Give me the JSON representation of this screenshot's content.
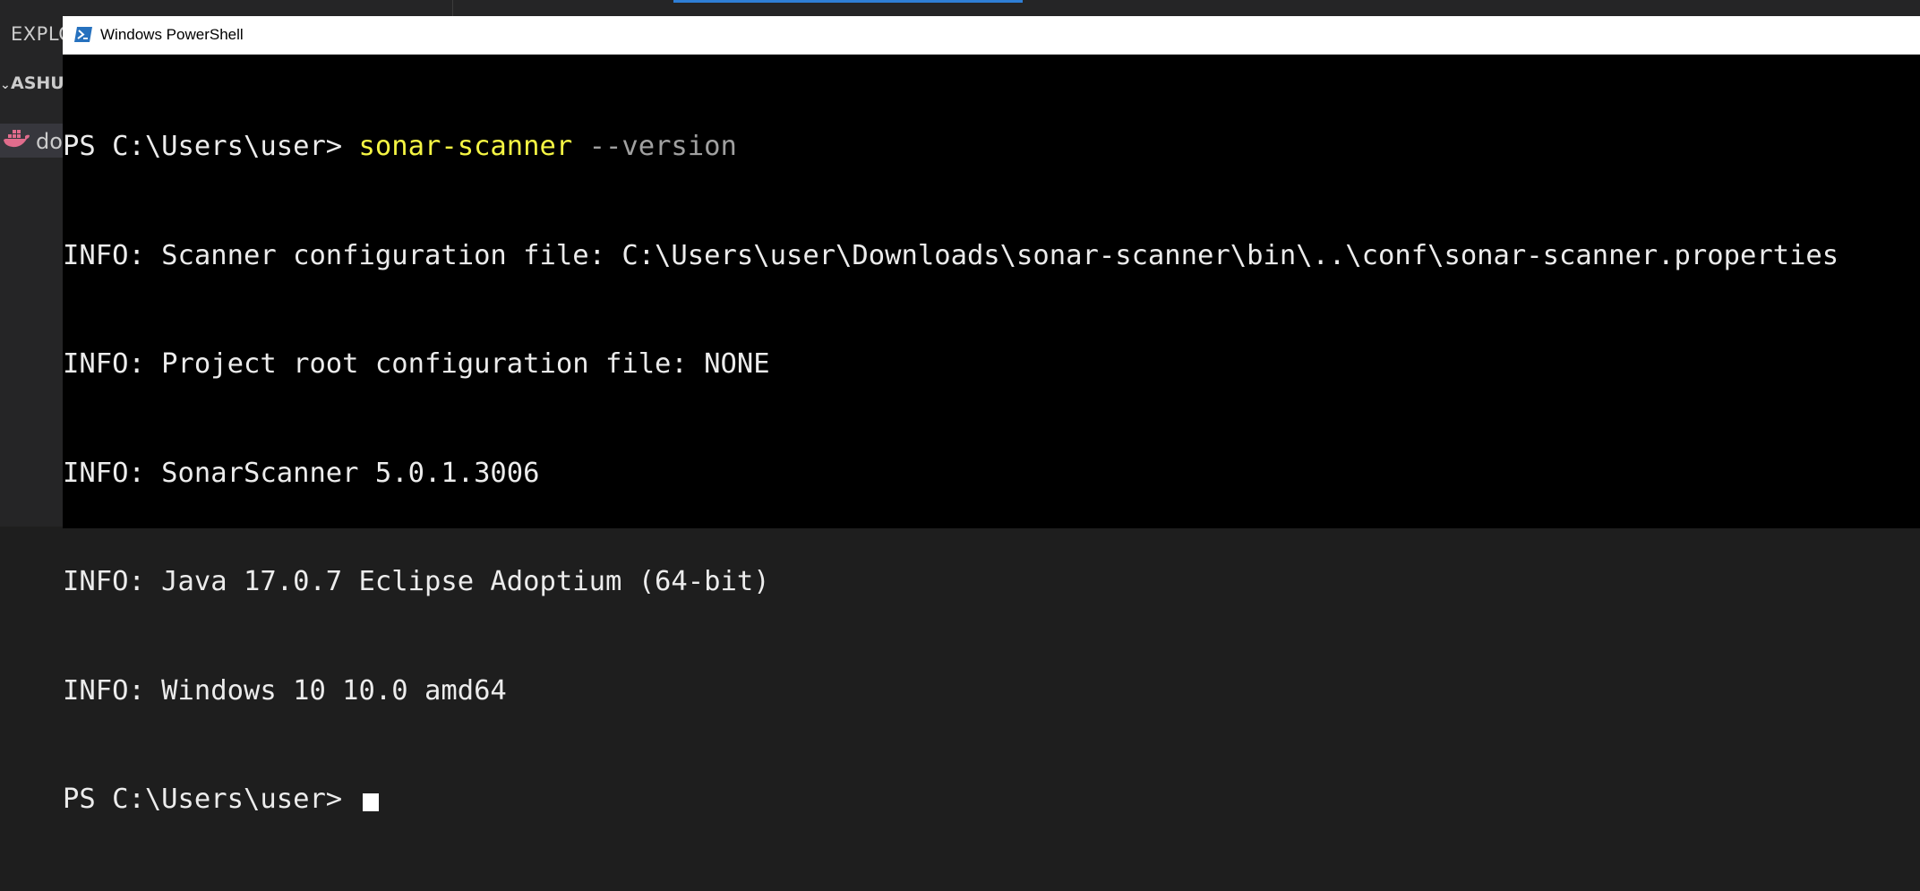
{
  "vscode": {
    "explorer_title": "EXPLORER",
    "folder_label": "ASHU",
    "file_label": "docker-compose.yml"
  },
  "powershell": {
    "window_title": "Windows PowerShell",
    "prompt": "PS C:\\Users\\user> ",
    "command": "sonar-scanner",
    "command_param": " --version",
    "output_lines": [
      "INFO: Scanner configuration file: C:\\Users\\user\\Downloads\\sonar-scanner\\bin\\..\\conf\\sonar-scanner.properties",
      "INFO: Project root configuration file: NONE",
      "INFO: SonarScanner 5.0.1.3006",
      "INFO: Java 17.0.7 Eclipse Adoptium (64-bit)",
      "INFO: Windows 10 10.0 amd64"
    ],
    "final_prompt": "PS C:\\Users\\user> "
  },
  "colors": {
    "console_bg": "#000000",
    "console_fg": "#ececec",
    "command": "#f5f543",
    "param": "#a0a0a0",
    "editor_bg": "#1e1e1e",
    "sidebar_bg": "#252526"
  },
  "icons": {
    "powershell": "powershell-icon",
    "docker": "docker-whale-icon",
    "chevron": "chevron-down-icon"
  }
}
